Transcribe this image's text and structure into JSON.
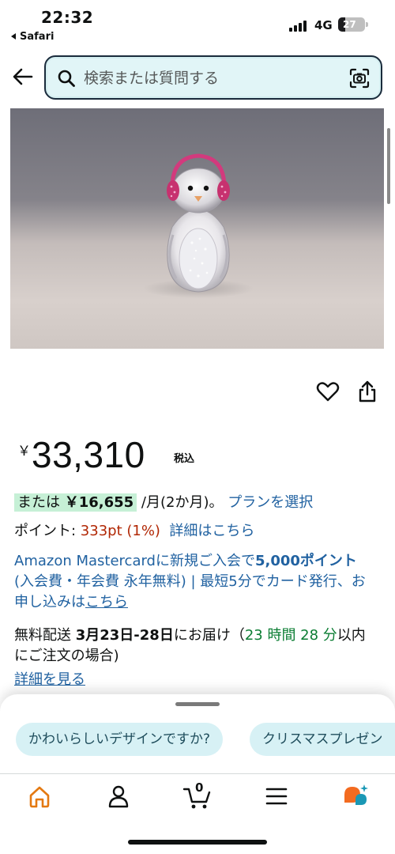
{
  "status_bar": {
    "time": "22:32",
    "back_app": "Safari",
    "network": "4G",
    "battery": "27"
  },
  "search": {
    "placeholder": "検索または質問する"
  },
  "price": {
    "currency": "￥",
    "amount": "33,310",
    "tax_label": "税込"
  },
  "installment": {
    "prefix": "または ",
    "amount": "￥16,655",
    "suffix": " /月(2か月)。 ",
    "link": "プランを選択"
  },
  "points": {
    "label": "ポイント: ",
    "value": "333pt  (1%)",
    "link": "詳細はこちら"
  },
  "promo": {
    "text1": "Amazon Mastercardに新規ご入会で",
    "bold": "5,000ポイント",
    "text2": " (入会費・年会費 永年無料) | 最短5分でカード発行、お申し込みは",
    "link": "こちら"
  },
  "delivery": {
    "label": "無料配送  ",
    "dates": "3月23日-28日",
    "text": "にお届け（",
    "countdown": "23 時間 28 分",
    "text2": "以内にご注文の場合)",
    "detail_link": "詳細を見る"
  },
  "suggestions": [
    "かわいらしいデザインですか?",
    "クリスマスプレゼン"
  ],
  "nav": {
    "cart_count": "0"
  },
  "colors": {
    "link": "#2162a1",
    "points_red": "#b12704",
    "countdown_green": "#0b7d33",
    "installment_bg": "#c6f0d6",
    "nav_active": "#e47911"
  }
}
